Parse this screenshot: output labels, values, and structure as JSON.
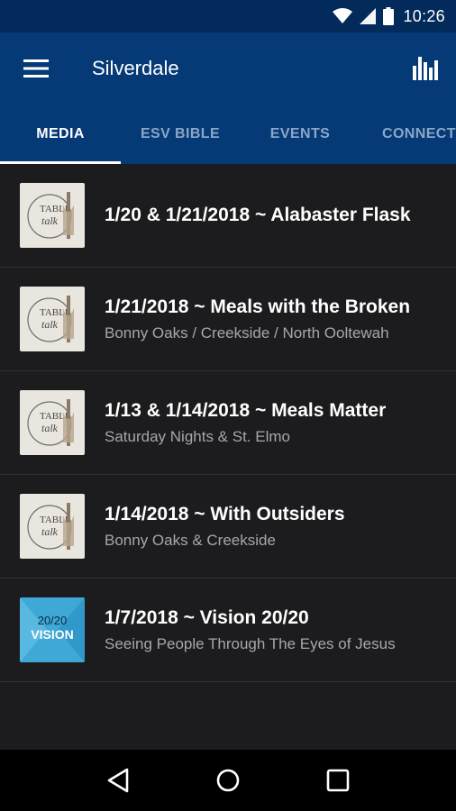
{
  "status_bar": {
    "time": "10:26",
    "icons": [
      "wifi-icon",
      "signal-icon",
      "battery-icon"
    ]
  },
  "app_bar": {
    "title": "Silverdale",
    "menu_icon": "hamburger-menu-icon",
    "action_icon": "bar-chart-icon"
  },
  "tabs": [
    {
      "label": "MEDIA",
      "active": true
    },
    {
      "label": "ESV BIBLE",
      "active": false
    },
    {
      "label": "EVENTS",
      "active": false
    },
    {
      "label": "CONNECT",
      "active": false
    }
  ],
  "media": [
    {
      "title": "1/20 & 1/21/2018 ~ Alabaster Flask",
      "subtitle": "",
      "thumb": "table-talk-thumbnail"
    },
    {
      "title": "1/21/2018 ~ Meals with the Broken",
      "subtitle": "Bonny Oaks / Creekside / North Ooltewah",
      "thumb": "table-talk-thumbnail"
    },
    {
      "title": "1/13 & 1/14/2018 ~ Meals Matter",
      "subtitle": "Saturday Nights & St. Elmo",
      "thumb": "table-talk-thumbnail"
    },
    {
      "title": "1/14/2018 ~ With Outsiders",
      "subtitle": "Bonny Oaks & Creekside",
      "thumb": "table-talk-thumbnail"
    },
    {
      "title": "1/7/2018 ~ Vision 20/20",
      "subtitle": "Seeing People Through The Eyes of Jesus",
      "thumb": "vision-2020-thumbnail"
    }
  ],
  "thumb_text": {
    "table_talk_line1": "TABLE",
    "table_talk_line2": "talk",
    "vision_line1": "20/20",
    "vision_line2": "VISION"
  },
  "nav_bar": {
    "icons": [
      "back-icon",
      "home-icon",
      "recents-icon"
    ]
  },
  "colors": {
    "app_bar": "#053a77",
    "status_bar": "#022a5a",
    "list_bg": "#1c1c1e",
    "inactive_tab": "#8aa6c8",
    "vision_thumb": "#3ea8d6"
  }
}
